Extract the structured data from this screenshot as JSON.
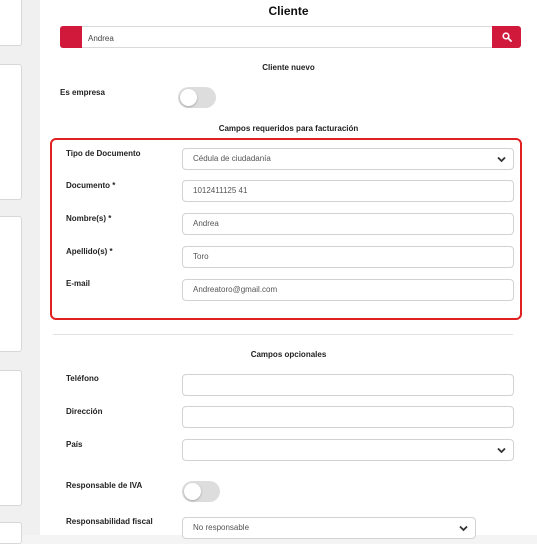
{
  "header": {
    "title": "Cliente"
  },
  "search": {
    "value": "Andrea",
    "button_icon": "search-icon"
  },
  "section_new": {
    "title": "Cliente nuevo",
    "es_empresa_label": "Es empresa",
    "es_empresa_on": false
  },
  "required": {
    "title": "Campos requeridos para facturación",
    "tipo_documento": {
      "label": "Tipo de Documento",
      "value": "Cédula de ciudadanía"
    },
    "documento": {
      "label": "Documento *",
      "value": "1012411125 41"
    },
    "nombres": {
      "label": "Nombre(s) *",
      "value": "Andrea"
    },
    "apellidos": {
      "label": "Apellido(s) *",
      "value": "Toro"
    },
    "email": {
      "label": "E-mail",
      "value": "Andreatoro@gmail.com"
    }
  },
  "optional": {
    "title": "Campos opcionales",
    "telefono": {
      "label": "Teléfono",
      "value": ""
    },
    "direccion": {
      "label": "Dirección",
      "value": ""
    },
    "pais": {
      "label": "País",
      "value": ""
    },
    "responsable_iva": {
      "label": "Responsable de IVA",
      "on": false
    },
    "responsabilidad_fiscal": {
      "label": "Responsabilidad fiscal",
      "value": "No responsable"
    }
  },
  "colors": {
    "accent": "#d1193c",
    "highlight": "#e02020"
  }
}
